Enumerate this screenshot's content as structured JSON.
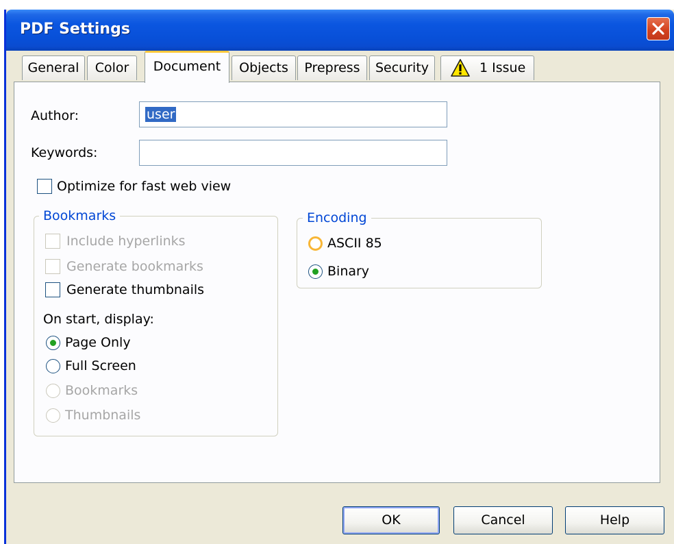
{
  "window": {
    "title": "PDF Settings"
  },
  "tabs": [
    {
      "label": "General"
    },
    {
      "label": "Color"
    },
    {
      "label": "Document"
    },
    {
      "label": "Objects"
    },
    {
      "label": "Prepress"
    },
    {
      "label": "Security"
    },
    {
      "label": "1 Issue",
      "icon": "warning-icon"
    }
  ],
  "document": {
    "author_label": "Author:",
    "author_value": "user",
    "keywords_label": "Keywords:",
    "keywords_value": "",
    "optimize_label": "Optimize for fast web view",
    "optimize_checked": false,
    "bookmarks": {
      "legend": "Bookmarks",
      "include_hyperlinks": "Include hyperlinks",
      "generate_bookmarks": "Generate bookmarks",
      "generate_thumbnails": "Generate thumbnails",
      "on_start_label": "On start, display:",
      "options": [
        {
          "label": "Page Only",
          "selected": true,
          "enabled": true
        },
        {
          "label": "Full Screen",
          "selected": false,
          "enabled": true
        },
        {
          "label": "Bookmarks",
          "selected": false,
          "enabled": false
        },
        {
          "label": "Thumbnails",
          "selected": false,
          "enabled": false
        }
      ]
    },
    "encoding": {
      "legend": "Encoding",
      "options": [
        {
          "label": "ASCII 85",
          "selected": false
        },
        {
          "label": "Binary",
          "selected": true
        }
      ]
    }
  },
  "buttons": {
    "ok": "OK",
    "cancel": "Cancel",
    "help": "Help"
  },
  "colors": {
    "title_bar": "#0a56e0",
    "accent": "#0046d5",
    "close_button": "#d4431f",
    "tab_highlight": "#ffc83c"
  }
}
